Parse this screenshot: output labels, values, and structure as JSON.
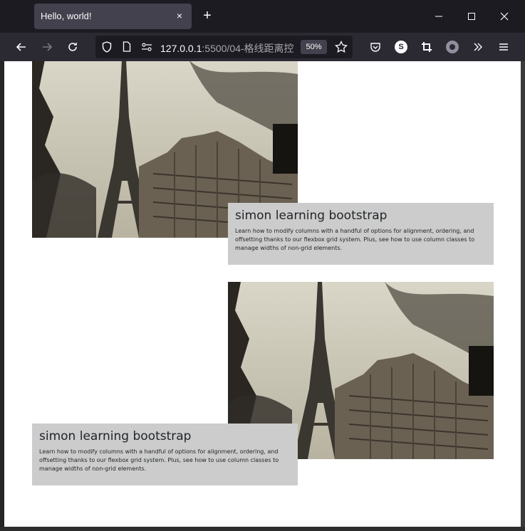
{
  "browser": {
    "tab_title": "Hello, world!",
    "tab_close": "×",
    "new_tab": "+",
    "url_host": "127.0.0.1",
    "url_path": ":5500/04-格线距离控",
    "zoom": "50%",
    "profile_badge": "S"
  },
  "cards": [
    {
      "title": "simon learning bootstrap",
      "text": "Learn how to modify columns with a handful of options for alignment, ordering, and offsetting thanks to our flexbox grid system. Plus, see how to use column classes to manage widths of non-grid elements."
    },
    {
      "title": "simon learning bootstrap",
      "text": "Learn how to modify columns with a handful of options for alignment, ordering, and offsetting thanks to our flexbox grid system. Plus, see how to use column classes to manage widths of non-grid elements."
    }
  ]
}
